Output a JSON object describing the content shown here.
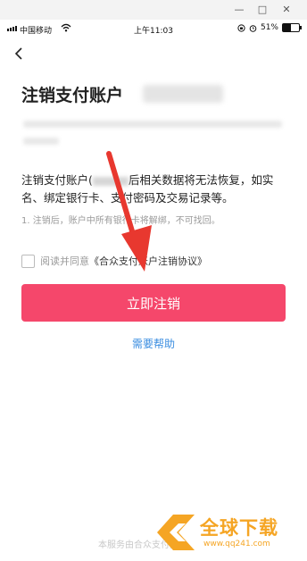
{
  "window": {
    "minimize_icon": "minimize-icon",
    "maximize_icon": "maximize-icon",
    "close_icon": "close-icon",
    "minimize_glyph": "—",
    "maximize_glyph": "□",
    "close_glyph": "✕"
  },
  "status_bar": {
    "carrier": "中国移动",
    "time": "上午11:03",
    "battery": "51%",
    "battery_level": 0.51
  },
  "page": {
    "title": "注销支付账户",
    "description_prefix": "注销支付账户(",
    "description_suffix": "后相关数据将无法恢复，如实名、绑定银行卡、支付密码及交易记录等。",
    "note": "1. 注销后，账户中所有银行卡将解绑，不可找回。",
    "agree_prefix": "阅读并同意",
    "agree_link": "《合众支付账户注销协议》",
    "button_label": "立即注销",
    "help_link": "需要帮助",
    "footer": "本服务由合众支付提供"
  },
  "watermark": {
    "text": "全球下载",
    "url": "www.qq241.com"
  },
  "colors": {
    "primary_button": "#f5476b",
    "link": "#3a8de0",
    "arrow": "#e8382f",
    "watermark": "#f5a524"
  }
}
